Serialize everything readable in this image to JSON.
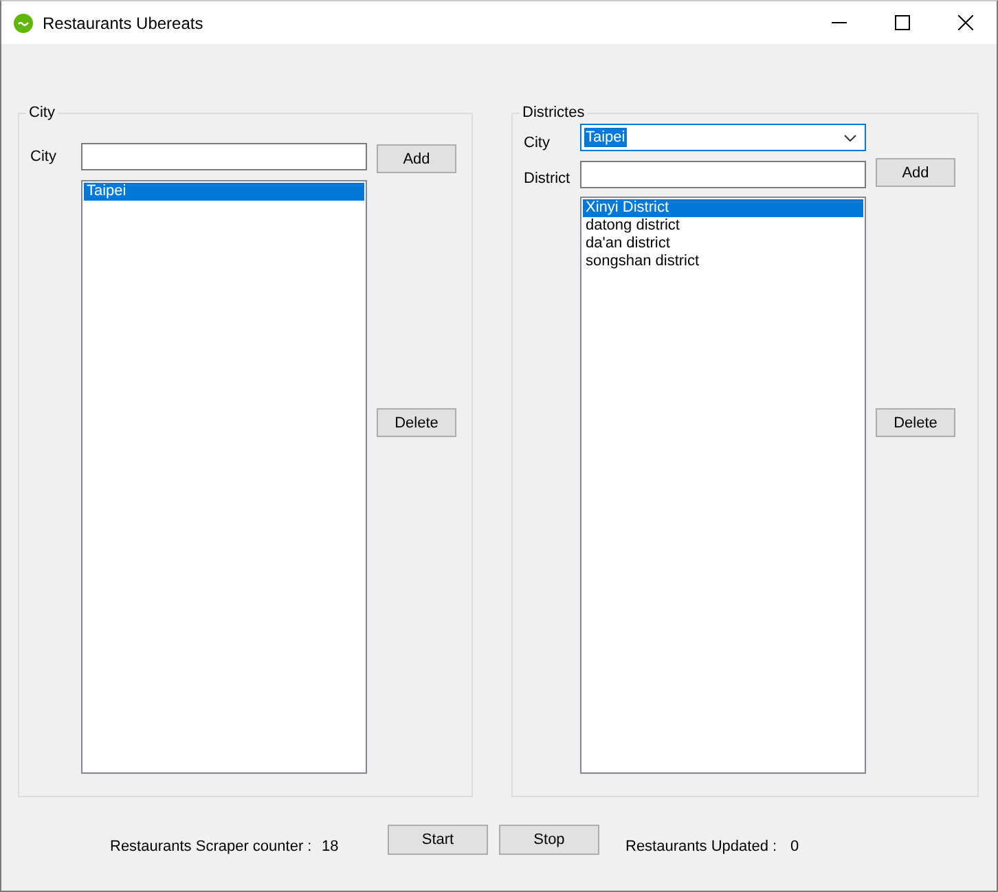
{
  "window": {
    "title": "Restaurants Ubereats"
  },
  "city_panel": {
    "title": "City",
    "field_label": "City",
    "add_button": "Add",
    "items": [
      {
        "label": "Taipei",
        "selected": true
      }
    ],
    "delete_button": "Delete"
  },
  "districts_panel": {
    "title": "Districtes",
    "city_label": "City",
    "city_select": {
      "value": "Taipei",
      "focused": true
    },
    "district_label": "District",
    "add_button": "Add",
    "items": [
      {
        "label": "Xinyi District",
        "selected": true
      },
      {
        "label": "datong district",
        "selected": false
      },
      {
        "label": "da'an district",
        "selected": false
      },
      {
        "label": "songshan district",
        "selected": false
      }
    ],
    "delete_button": "Delete"
  },
  "footer": {
    "scraper_counter_label": "Restaurants Scraper counter :",
    "scraper_counter": "18",
    "start_button": "Start",
    "stop_button": "Stop",
    "updated_label": "Restaurants Updated :",
    "updated_count": "0"
  }
}
